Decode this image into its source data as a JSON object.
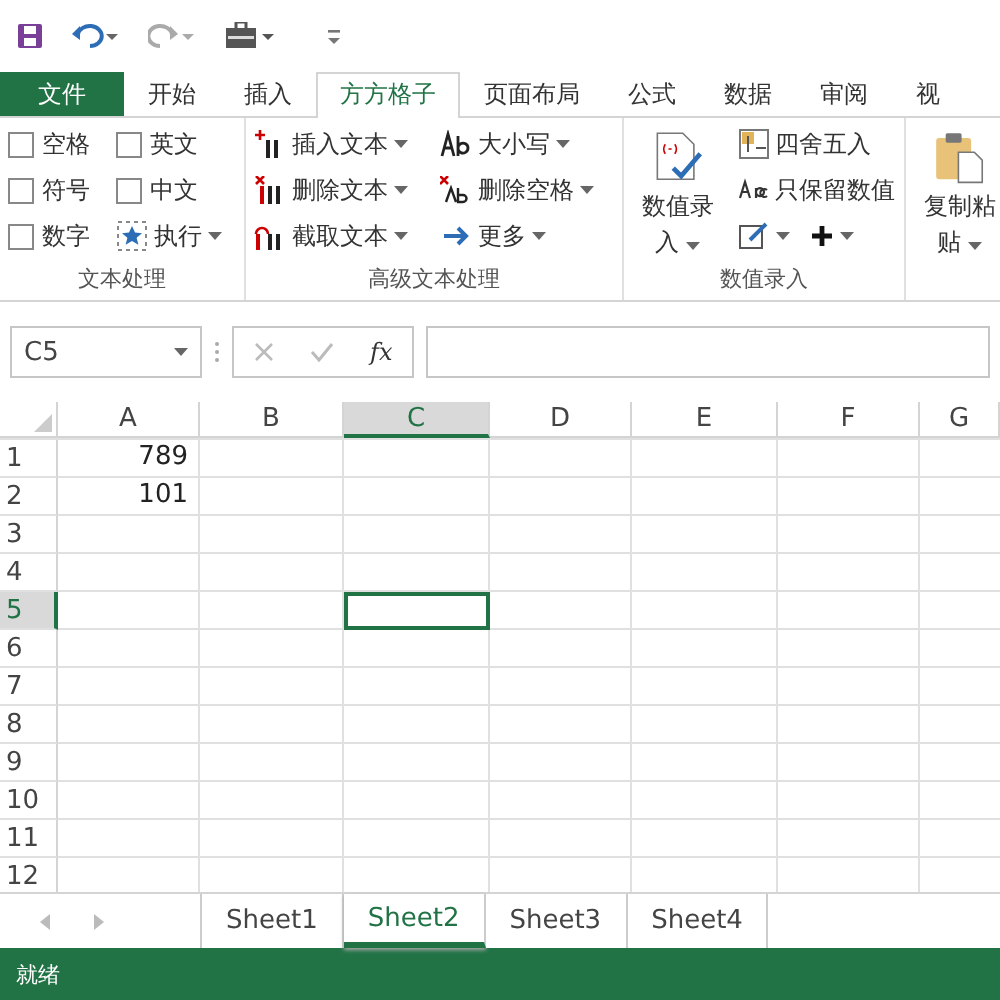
{
  "ribbon_tabs": [
    {
      "label": "文件",
      "kind": "file",
      "selected": false
    },
    {
      "label": "开始",
      "kind": "tab",
      "selected": false
    },
    {
      "label": "插入",
      "kind": "tab",
      "selected": false
    },
    {
      "label": "方方格子",
      "kind": "tab",
      "selected": true
    },
    {
      "label": "页面布局",
      "kind": "tab",
      "selected": false
    },
    {
      "label": "公式",
      "kind": "tab",
      "selected": false
    },
    {
      "label": "数据",
      "kind": "tab",
      "selected": false
    },
    {
      "label": "审阅",
      "kind": "tab",
      "selected": false
    },
    {
      "label": "视",
      "kind": "tab",
      "selected": false
    }
  ],
  "ribbon_groups": [
    {
      "title": "文本处理",
      "kind": "grid",
      "items": [
        {
          "kind": "checkbox",
          "label": "空格",
          "checked": false
        },
        {
          "kind": "checkbox",
          "label": "英文",
          "checked": false
        },
        {
          "kind": "checkbox",
          "label": "符号",
          "checked": false
        },
        {
          "kind": "checkbox",
          "label": "中文",
          "checked": false
        },
        {
          "kind": "checkbox",
          "label": "数字",
          "checked": false
        },
        {
          "kind": "menu",
          "label": "执行",
          "dropdown": true
        }
      ]
    },
    {
      "title": "高级文本处理",
      "kind": "columns",
      "items": [
        {
          "kind": "menu",
          "label": "插入文本",
          "dropdown": true
        },
        {
          "kind": "menu",
          "label": "删除文本",
          "dropdown": true
        },
        {
          "kind": "menu",
          "label": "截取文本",
          "dropdown": true
        },
        {
          "kind": "menu",
          "label": "大小写",
          "dropdown": true
        },
        {
          "kind": "menu",
          "label": "删除空格",
          "dropdown": true
        },
        {
          "kind": "menu",
          "label": "更多",
          "dropdown": true
        }
      ]
    },
    {
      "title": "数值录入",
      "kind": "large",
      "items": [
        {
          "kind": "large",
          "label": "数值录入",
          "dropdown": true
        },
        {
          "kind": "menu",
          "label": "四舍五入",
          "dropdown": false
        },
        {
          "kind": "menu",
          "label": "只保留数值",
          "dropdown": false
        },
        {
          "kind": "icons"
        }
      ]
    },
    {
      "kind": "large",
      "items": [
        {
          "kind": "large",
          "label": "复制粘贴",
          "dropdown": true
        }
      ]
    }
  ],
  "name_box": {
    "value": "C5"
  },
  "formula_bar": {
    "fx": "fx"
  },
  "columns": [
    {
      "label": "A",
      "selected": false
    },
    {
      "label": "B",
      "selected": false
    },
    {
      "label": "C",
      "selected": true
    },
    {
      "label": "D",
      "selected": false
    },
    {
      "label": "E",
      "selected": false
    },
    {
      "label": "F",
      "selected": false
    },
    {
      "label": "G",
      "selected": false
    }
  ],
  "rows": [
    {
      "label": "1",
      "selected": false,
      "cells": [
        "789"
      ]
    },
    {
      "label": "2",
      "selected": false,
      "cells": [
        "101"
      ]
    },
    {
      "label": "3",
      "selected": false,
      "cells": []
    },
    {
      "label": "4",
      "selected": false,
      "cells": []
    },
    {
      "label": "5",
      "selected": true,
      "cells": []
    },
    {
      "label": "6",
      "selected": false,
      "cells": []
    },
    {
      "label": "7",
      "selected": false,
      "cells": []
    },
    {
      "label": "8",
      "selected": false,
      "cells": []
    },
    {
      "label": "9",
      "selected": false,
      "cells": []
    },
    {
      "label": "10",
      "selected": false,
      "cells": []
    },
    {
      "label": "11",
      "selected": false,
      "cells": []
    },
    {
      "label": "12",
      "selected": false,
      "cells": []
    }
  ],
  "sheet_tabs": [
    {
      "label": "Sheet1",
      "selected": false
    },
    {
      "label": "Sheet2",
      "selected": true
    },
    {
      "label": "Sheet3",
      "selected": false
    },
    {
      "label": "Sheet4",
      "selected": false
    }
  ],
  "status_bar": {
    "text": "就绪"
  }
}
